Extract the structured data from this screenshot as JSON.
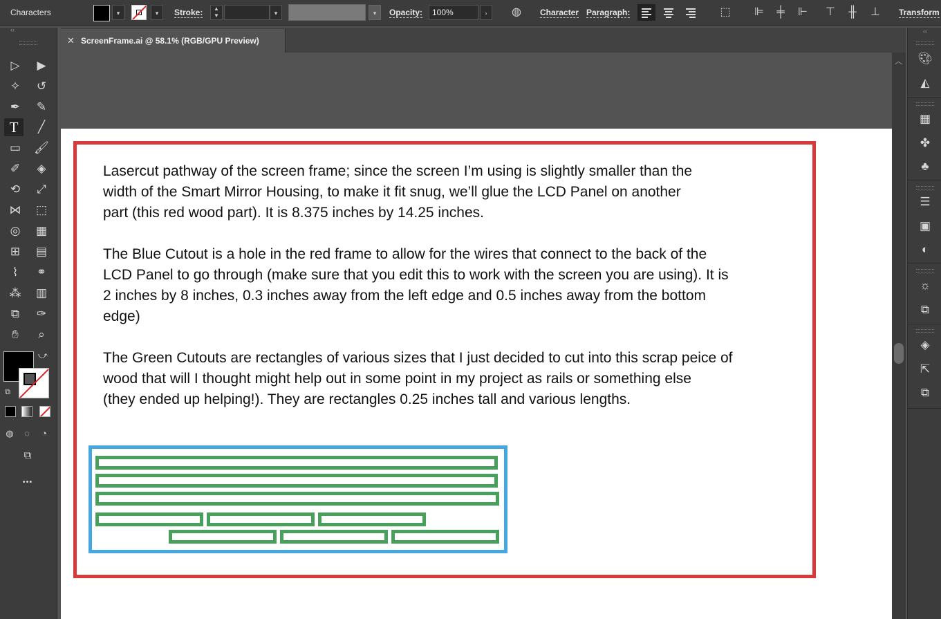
{
  "control_bar": {
    "panel_name": "Characters",
    "stroke_label": "Stroke:",
    "opacity_label": "Opacity:",
    "opacity_value": "100%",
    "character_link": "Character",
    "paragraph_link": "Paragraph:",
    "transform_link": "Transform"
  },
  "document_tab": {
    "close_glyph": "✕",
    "title": "ScreenFrame.ai @ 58.1% (RGB/GPU Preview)"
  },
  "artboard": {
    "paragraphs": [
      "Lasercut pathway of the screen frame; since the screen I’m using is slightly smaller than the\nwidth of the Smart Mirror Housing, to make it fit snug, we’ll glue the LCD Panel on another\npart (this red wood part). It is 8.375 inches by 14.25 inches.",
      "The Blue Cutout is a hole in the red frame to allow for the wires that connect to the back of the\nLCD Panel to go through (make sure that you edit this to work with the screen you are using). It is\n2 inches by 8 inches, 0.3 inches away from the left edge and 0.5 inches away from the bottom\nedge)",
      "The Green Cutouts are rectangles of various sizes that I just decided to cut into this scrap peice of\nwood that will I thought might help out in some point in my project as rails or something else\n(they ended up helping!). They are rectangles 0.25 inches tall and various lengths."
    ],
    "colors": {
      "red_frame": "#d8393a",
      "blue_cutout": "#45a6e0",
      "green_cutouts": "#48a05c"
    }
  },
  "toolbar": {
    "more_glyph": "•••"
  }
}
